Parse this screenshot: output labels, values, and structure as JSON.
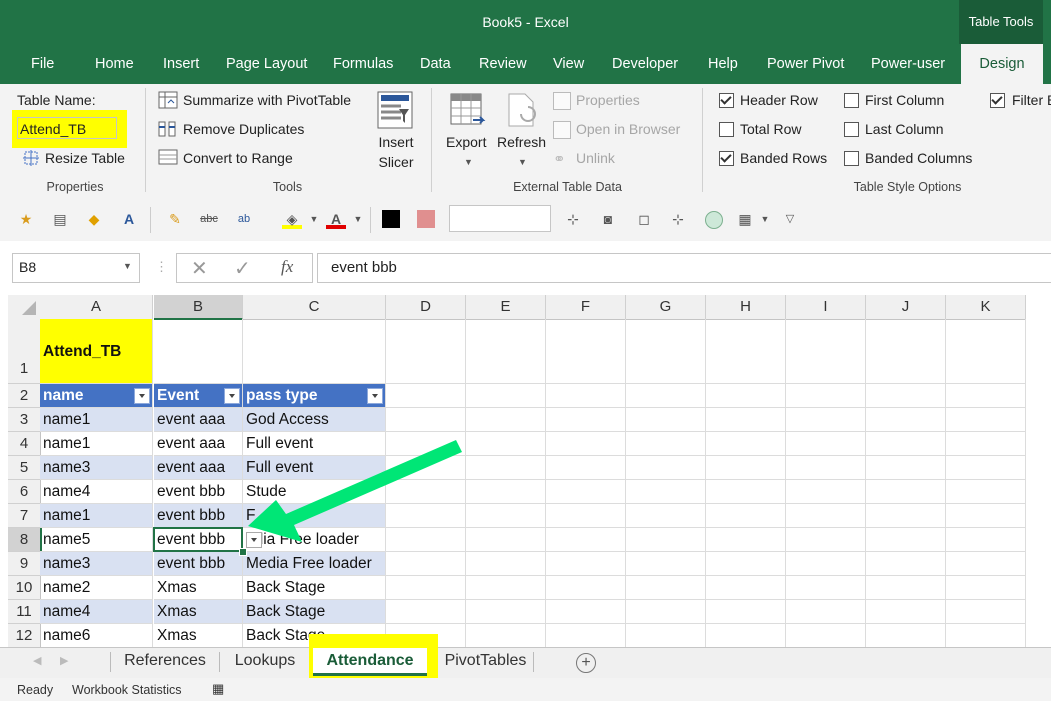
{
  "window": {
    "title": "Book5  -  Excel",
    "context_tab": "Table Tools"
  },
  "ribbon_tabs": [
    "File",
    "Home",
    "Insert",
    "Page Layout",
    "Formulas",
    "Data",
    "Review",
    "View",
    "Developer",
    "Help",
    "Power Pivot",
    "Power-user",
    "Design"
  ],
  "properties_group": {
    "table_name_label": "Table Name:",
    "table_name_value": "Attend_TB",
    "resize_label": "Resize Table",
    "group_label": "Properties"
  },
  "tools_group": {
    "summarize": "Summarize with PivotTable",
    "remove_duplicates": "Remove Duplicates",
    "convert": "Convert to Range",
    "insert_slicer_line1": "Insert",
    "insert_slicer_line2": "Slicer",
    "group_label": "Tools"
  },
  "external_group": {
    "export": "Export",
    "refresh": "Refresh",
    "properties": "Properties",
    "open_browser": "Open in Browser",
    "unlink": "Unlink",
    "group_label": "External Table Data"
  },
  "style_options": {
    "header_row": "Header Row",
    "total_row": "Total Row",
    "banded_rows": "Banded Rows",
    "first_column": "First Column",
    "last_column": "Last Column",
    "banded_columns": "Banded Columns",
    "filter_button": "Filter B",
    "group_label": "Table Style Options",
    "checked": {
      "header_row": true,
      "total_row": false,
      "banded_rows": true,
      "first_column": false,
      "last_column": false,
      "banded_columns": false,
      "filter_button": true
    }
  },
  "formula_bar": {
    "name_box": "B8",
    "formula": "event bbb",
    "fx": "fx"
  },
  "columns": [
    "A",
    "B",
    "C",
    "D",
    "E",
    "F",
    "G",
    "H",
    "I",
    "J",
    "K"
  ],
  "rows": [
    "1",
    "2",
    "3",
    "4",
    "5",
    "6",
    "7",
    "8",
    "9",
    "10",
    "11",
    "12"
  ],
  "cell_a1": "Attend_TB",
  "table": {
    "headers": [
      "name",
      "Event",
      "pass type"
    ],
    "rows": [
      [
        "name1",
        "event aaa",
        "God Access"
      ],
      [
        "name1",
        "event aaa",
        "Full event"
      ],
      [
        "name3",
        "event aaa",
        "Full event"
      ],
      [
        "name4",
        "event bbb",
        "Stude"
      ],
      [
        "name1",
        "event bbb",
        "F"
      ],
      [
        "name5",
        "event bbb",
        "edia Free loader"
      ],
      [
        "name3",
        "event bbb",
        "Media Free loader"
      ],
      [
        "name2",
        "Xmas",
        "Back Stage"
      ],
      [
        "name4",
        "Xmas",
        "Back Stage"
      ],
      [
        "name6",
        "Xmas",
        "Back Stage"
      ]
    ]
  },
  "sheet_tabs": [
    "References",
    "Lookups",
    "Attendance",
    "PivotTables"
  ],
  "active_sheet": "Attendance",
  "status": {
    "ready": "Ready",
    "stats": "Workbook Statistics"
  },
  "colors": {
    "excel_green": "#217346",
    "table_header": "#4472c4",
    "band": "#d9e1f2",
    "highlight": "#ffff00",
    "arrow": "#00e676"
  }
}
